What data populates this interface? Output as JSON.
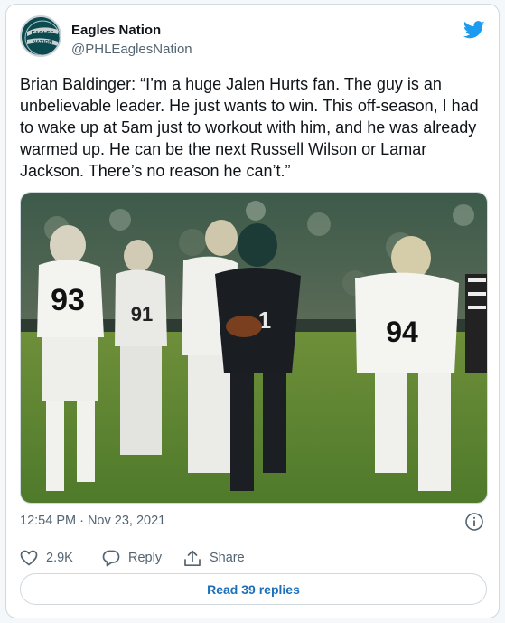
{
  "user": {
    "name": "Eagles Nation",
    "handle": "@PHLEaglesNation",
    "avatar_text": "EAGLES NATION",
    "avatar_icon": "eagles-nation-logo-icon"
  },
  "tweet": {
    "text": "Brian Baldinger: “I’m a huge Jalen Hurts fan. The guy is an unbelievable leader. He just wants to win. This off-season, I had to wake up at 5am just to workout with him, and he was already warmed up. He can be the next Russell Wilson or Lamar Jackson. There’s no reason he can’t.”",
    "timestamp": "12:54 PM · Nov 23, 2021"
  },
  "actions": {
    "like_count": "2.9K",
    "reply_label": "Reply",
    "share_label": "Share"
  },
  "read_replies_label": "Read 39 replies",
  "colors": {
    "twitter_blue": "#1d9bf0",
    "link_blue": "#1d6fb8",
    "muted_text": "#536471",
    "border": "#cfd9de"
  },
  "icons": [
    "twitter-bird-icon",
    "info-icon",
    "heart-icon",
    "reply-bubble-icon",
    "share-icon"
  ]
}
